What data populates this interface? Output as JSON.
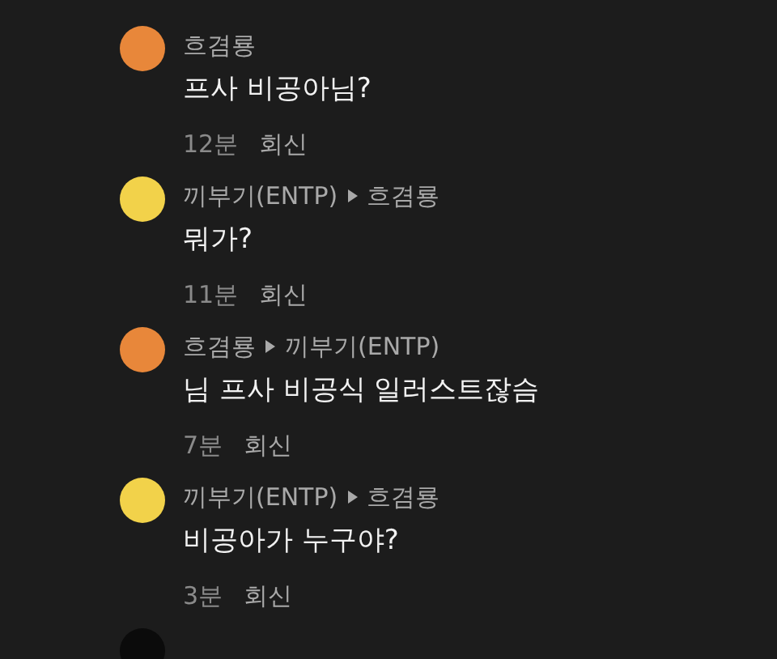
{
  "comments": [
    {
      "author": "흐겸룡",
      "color": "#e8873a",
      "text": "프사 비공아님?",
      "time": "12분",
      "reply_label": "회신"
    },
    {
      "author": "끼부기(ENTP)",
      "reply_to": "흐겸룡",
      "color": "#f2d24a",
      "text": "뭐가?",
      "time": "11분",
      "reply_label": "회신"
    },
    {
      "author": "흐겸룡",
      "reply_to": "끼부기(ENTP)",
      "color": "#e8873a",
      "text": "님 프사 비공식 일러스트잖슴",
      "time": "7분",
      "reply_label": "회신"
    },
    {
      "author": "끼부기(ENTP)",
      "reply_to": "흐겸룡",
      "color": "#f2d24a",
      "text": "비공아가 누구야?",
      "time": "3분",
      "reply_label": "회신"
    },
    {
      "color": "#0b0b0b"
    }
  ]
}
